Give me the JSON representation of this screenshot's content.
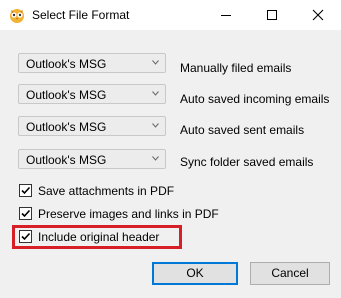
{
  "window": {
    "title": "Select File Format",
    "icon": "app-owl-icon",
    "controls": [
      "minimize-icon",
      "maximize-icon",
      "close-icon"
    ]
  },
  "rows": [
    {
      "format": "Outlook's MSG",
      "label": "Manually filed emails"
    },
    {
      "format": "Outlook's MSG",
      "label": "Auto saved incoming emails"
    },
    {
      "format": "Outlook's MSG",
      "label": "Auto saved sent emails"
    },
    {
      "format": "Outlook's MSG",
      "label": "Sync folder saved emails"
    }
  ],
  "options": [
    {
      "label": "Save attachments in PDF",
      "checked": true
    },
    {
      "label": "Preserve images and links in PDF",
      "checked": true
    },
    {
      "label": "Include original header",
      "checked": true,
      "highlighted": true
    }
  ],
  "buttons": {
    "ok": "OK",
    "cancel": "Cancel"
  },
  "colors": {
    "highlight": "#d61f26",
    "focus": "#0078d7"
  }
}
